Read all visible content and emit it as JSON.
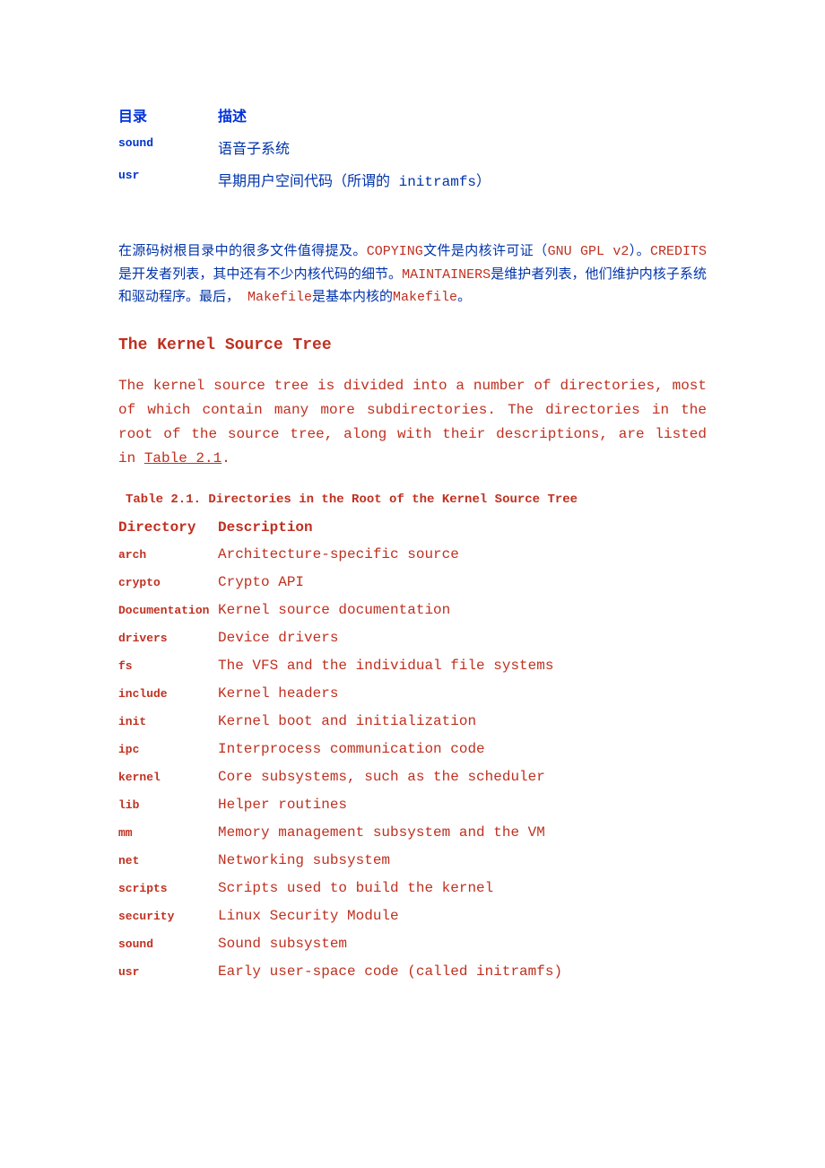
{
  "top_table": {
    "header_dir": "目录",
    "header_desc": "描述",
    "rows": [
      {
        "dir": "sound",
        "desc": "语音子系统"
      },
      {
        "dir": "usr",
        "desc": "早期用户空间代码（所谓的 initramfs）"
      }
    ]
  },
  "paragraph_parts": {
    "p1": "在源码树根目录中的很多文件值得提及。",
    "p2": "COPYING",
    "p3": "文件是内核许可证（",
    "p4": "GNU GPL v2",
    "p5": "）。",
    "p6": "CREDITS",
    "p7": "是开发者列表，其中还有不少内核代码的细节。",
    "p8": "MAINTAINERS",
    "p9": "是维护者列表，他们维护内核子系统和驱动程序。最后， ",
    "p10": "Makefile",
    "p11": "是基本内核的",
    "p12": "Makefile",
    "p13": "。"
  },
  "section_heading": "The Kernel Source Tree",
  "intro_paragraph_pre": "The kernel source tree is divided into a number of directories, most of which contain many more subdirectories. The directories in the root of the source tree, along with their descriptions, are listed in ",
  "intro_table_ref": "Table 2.1",
  "intro_paragraph_post": ".",
  "table_caption": "Table 2.1. Directories in the Root of the Kernel Source Tree",
  "main_table": {
    "header_dir": "Directory",
    "header_desc": "Description",
    "rows": [
      {
        "dir": "arch",
        "desc": "Architecture-specific source"
      },
      {
        "dir": "crypto",
        "desc": "Crypto API"
      },
      {
        "dir": "Documentation",
        "desc": "Kernel source documentation"
      },
      {
        "dir": "drivers",
        "desc": "Device drivers"
      },
      {
        "dir": "fs",
        "desc": "The VFS and the individual file systems"
      },
      {
        "dir": "include",
        "desc": "Kernel headers"
      },
      {
        "dir": "init",
        "desc": "Kernel boot and initialization"
      },
      {
        "dir": "ipc",
        "desc": "Interprocess communication code"
      },
      {
        "dir": "kernel",
        "desc": "Core subsystems, such as the scheduler"
      },
      {
        "dir": "lib",
        "desc": "Helper routines"
      },
      {
        "dir": "mm",
        "desc": "Memory management subsystem and the VM"
      },
      {
        "dir": "net",
        "desc": "Networking subsystem"
      },
      {
        "dir": "scripts",
        "desc": "Scripts used to build the kernel"
      },
      {
        "dir": "security",
        "desc": "Linux Security Module"
      },
      {
        "dir": "sound",
        "desc": "Sound subsystem"
      },
      {
        "dir": "usr",
        "desc": "Early user-space code (called initramfs)"
      }
    ]
  }
}
